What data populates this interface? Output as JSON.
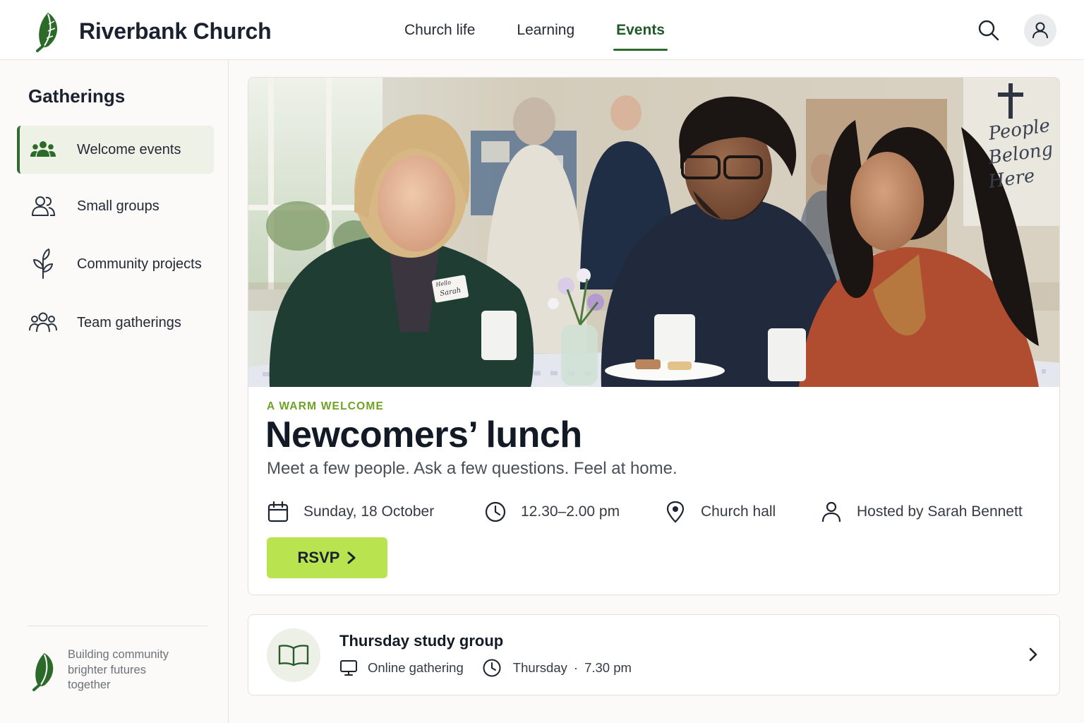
{
  "header": {
    "brand_name": "Riverbank Church",
    "nav": [
      {
        "label": "Church life",
        "active": false
      },
      {
        "label": "Learning",
        "active": false
      },
      {
        "label": "Events",
        "active": true
      }
    ],
    "icons": {
      "search": "search-icon",
      "account": "user-icon",
      "logo": "leaf-icon"
    }
  },
  "sidebar": {
    "title": "Gatherings",
    "items": [
      {
        "label": "Welcome events",
        "icon": "people-group-icon",
        "active": true
      },
      {
        "label": "Small groups",
        "icon": "users-icon",
        "active": false
      },
      {
        "label": "Community projects",
        "icon": "sprout-icon",
        "active": false
      },
      {
        "label": "Team gatherings",
        "icon": "team-icon",
        "active": false
      }
    ],
    "tagline": "Building community brighter futures together"
  },
  "featured": {
    "eyebrow": "A WARM WELCOME",
    "title": "Newcomers’ lunch",
    "subtitle": "Meet a few people. Ask a few questions. Feel at home.",
    "date": "Sunday, 18 October",
    "time": "12.30–2.00 pm",
    "location": "Church hall",
    "host": "Hosted by Sarah Bennett",
    "rsvp_label": "RSVP",
    "photo": {
      "name_tag_line1": "Hello",
      "name_tag_line2": "Sarah",
      "banner_text": [
        "People",
        "Belong",
        "Here"
      ]
    }
  },
  "next_event": {
    "title": "Thursday study group",
    "mode": "Online gathering",
    "day": "Thursday",
    "separator": "·",
    "time": "7.30 pm",
    "icon": "book-icon"
  },
  "colors": {
    "brand_green": "#2f6b2f",
    "accent_lime": "#b9e34f",
    "eyebrow_green": "#6ea225",
    "active_bg": "#eef2e6"
  }
}
